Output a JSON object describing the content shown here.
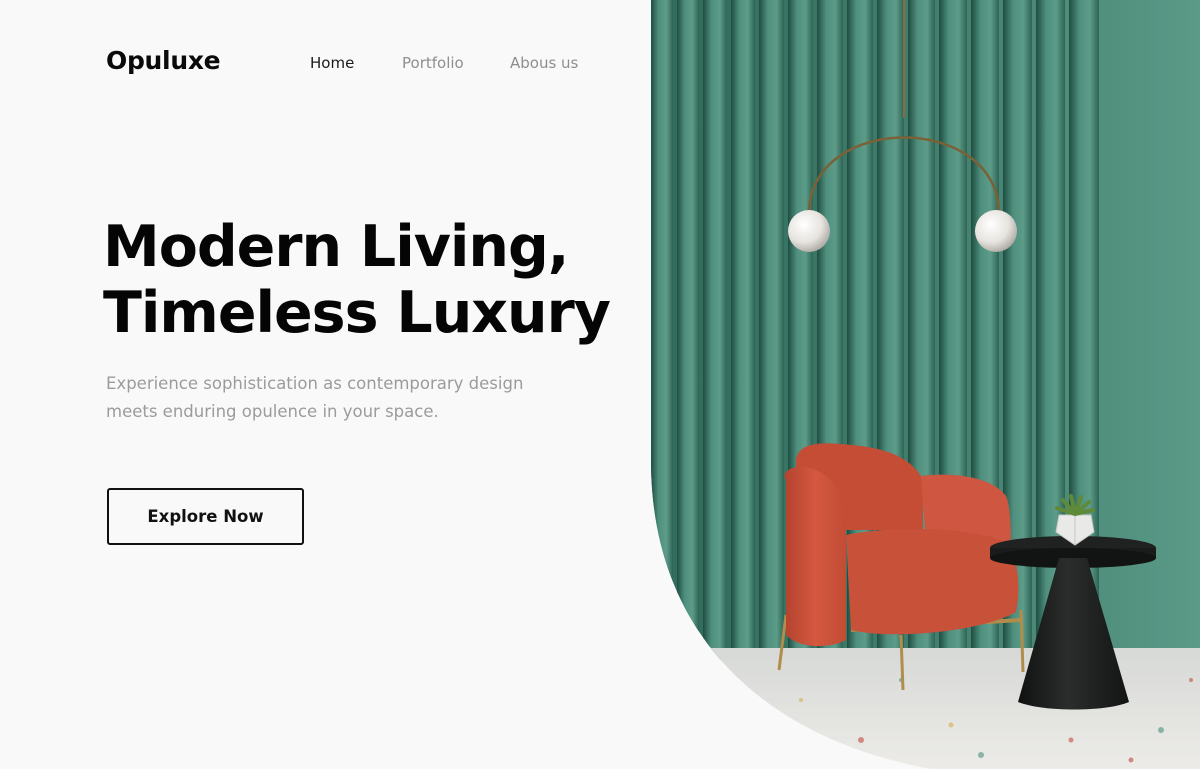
{
  "brand": {
    "logo": "Opuluxe"
  },
  "nav": {
    "items": [
      {
        "label": "Home",
        "active": true
      },
      {
        "label": "Portfolio",
        "active": false
      },
      {
        "label": "Abous us",
        "active": false
      }
    ]
  },
  "hero": {
    "headline_line1": "Modern Living,",
    "headline_line2": "Timeless Luxury",
    "subtext_line1": "Experience sophistication as contemporary design",
    "subtext_line2": "meets enduring opulence in your space.",
    "cta_label": "Explore Now"
  },
  "colors": {
    "background": "#f9f9f9",
    "text_primary": "#0b0b0b",
    "text_muted": "#9b9b9b",
    "wall_green": "#4c8a78",
    "chair_coral": "#d1573f",
    "table_black": "#1a1c1b"
  },
  "scene": {
    "illustration": "interior-scene-armchair-pendant-lamp"
  }
}
